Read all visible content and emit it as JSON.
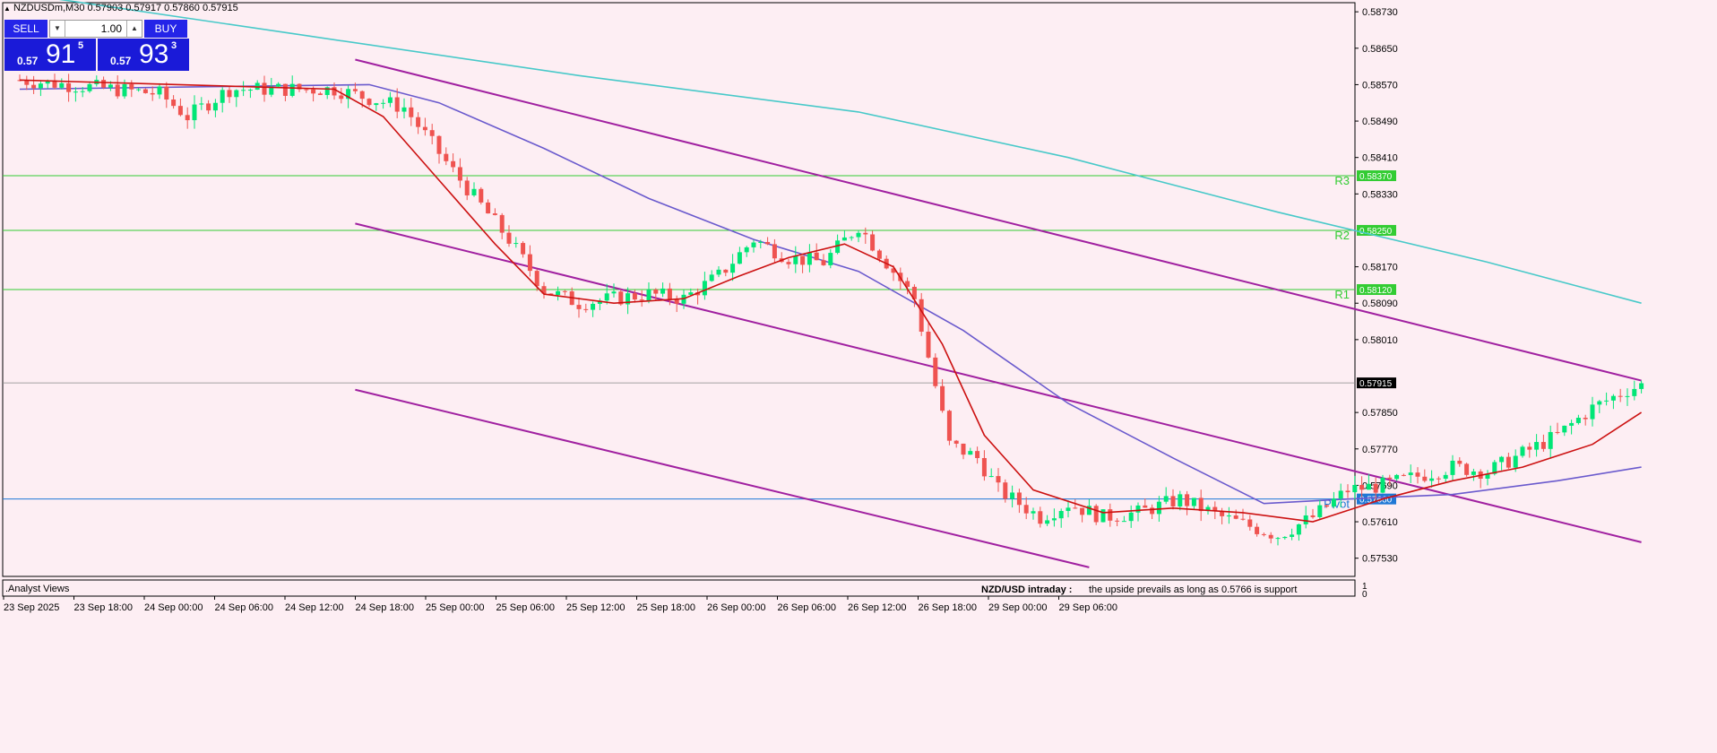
{
  "symbol_line": "NZDUSDm,M30  0.57903 0.57917 0.57860 0.57915",
  "trade_panel": {
    "sell_label": "SELL",
    "buy_label": "BUY",
    "lot": "1.00",
    "sell_prefix": "0.57",
    "sell_big": "91",
    "sell_sup": "5",
    "buy_prefix": "0.57",
    "buy_big": "93",
    "buy_sup": "3"
  },
  "subwindow_label": ".Analyst Views",
  "subwindow_scale": [
    "1",
    "0"
  ],
  "analyst_text": {
    "title": "NZD/USD intraday :",
    "body": "the upside prevails as long as 0.5766 is support"
  },
  "colors": {
    "background": "#fdeef3",
    "bull": "#00e676",
    "bear": "#ef5350",
    "sma_fast": "#cc1111",
    "sma_mid": "#6a5acd",
    "sma_slow": "#48c9c9",
    "channel": "#a020a0",
    "resistance": "#33cc33",
    "pivot": "#1f78d6",
    "price_line": "#888888"
  },
  "chart_data": {
    "type": "candlestick",
    "timeframe": "M30",
    "ylim": [
      0.5749,
      0.5875
    ],
    "y_ticks": [
      "0.58730",
      "0.58650",
      "0.58570",
      "0.58490",
      "0.58410",
      "0.58330",
      "0.58170",
      "0.58090",
      "0.58010",
      "0.57850",
      "0.57770",
      "0.57690",
      "0.57610",
      "0.57530"
    ],
    "x_ticks": [
      "23 Sep 2025",
      "23 Sep 18:00",
      "24 Sep 00:00",
      "24 Sep 06:00",
      "24 Sep 12:00",
      "24 Sep 18:00",
      "25 Sep 00:00",
      "25 Sep 06:00",
      "25 Sep 12:00",
      "25 Sep 18:00",
      "26 Sep 00:00",
      "26 Sep 06:00",
      "26 Sep 12:00",
      "26 Sep 18:00",
      "29 Sep 00:00",
      "29 Sep 06:00"
    ],
    "current_price": "0.57915",
    "levels": [
      {
        "name": "R3",
        "value": "0.58370",
        "color": "#33cc33"
      },
      {
        "name": "R2",
        "value": "0.58250",
        "color": "#33cc33"
      },
      {
        "name": "R1",
        "value": "0.58120",
        "color": "#33cc33"
      },
      {
        "name": "Pivot",
        "value": "0.57660",
        "color": "#1f78d6"
      }
    ],
    "candle_keypoints": [
      [
        0,
        0.5858
      ],
      [
        20,
        0.5855
      ],
      [
        24,
        0.585
      ],
      [
        30,
        0.5856
      ],
      [
        45,
        0.5856
      ],
      [
        55,
        0.5852
      ],
      [
        62,
        0.5838
      ],
      [
        70,
        0.5823
      ],
      [
        75,
        0.5812
      ],
      [
        80,
        0.5809
      ],
      [
        90,
        0.5811
      ],
      [
        95,
        0.581
      ],
      [
        100,
        0.5815
      ],
      [
        105,
        0.5823
      ],
      [
        110,
        0.5819
      ],
      [
        115,
        0.5818
      ],
      [
        120,
        0.5826
      ],
      [
        125,
        0.5816
      ],
      [
        128,
        0.581
      ],
      [
        133,
        0.5778
      ],
      [
        137,
        0.5775
      ],
      [
        140,
        0.5768
      ],
      [
        146,
        0.5762
      ],
      [
        150,
        0.5765
      ],
      [
        155,
        0.5762
      ],
      [
        160,
        0.5763
      ],
      [
        166,
        0.5766
      ],
      [
        172,
        0.5762
      ],
      [
        180,
        0.5758
      ],
      [
        185,
        0.5762
      ],
      [
        190,
        0.5768
      ],
      [
        195,
        0.5769
      ],
      [
        200,
        0.5771
      ],
      [
        205,
        0.5773
      ],
      [
        210,
        0.5772
      ],
      [
        215,
        0.5776
      ],
      [
        220,
        0.578
      ],
      [
        225,
        0.5786
      ],
      [
        230,
        0.579
      ],
      [
        232,
        0.5791
      ]
    ],
    "sma_fast_points": [
      [
        0,
        0.5858
      ],
      [
        45,
        0.5856
      ],
      [
        52,
        0.585
      ],
      [
        60,
        0.5836
      ],
      [
        68,
        0.5822
      ],
      [
        75,
        0.5811
      ],
      [
        85,
        0.5809
      ],
      [
        95,
        0.581
      ],
      [
        103,
        0.5815
      ],
      [
        110,
        0.5819
      ],
      [
        118,
        0.5822
      ],
      [
        125,
        0.5817
      ],
      [
        132,
        0.58
      ],
      [
        138,
        0.578
      ],
      [
        145,
        0.5768
      ],
      [
        155,
        0.5763
      ],
      [
        165,
        0.5764
      ],
      [
        175,
        0.5763
      ],
      [
        185,
        0.5761
      ],
      [
        195,
        0.5766
      ],
      [
        205,
        0.577
      ],
      [
        215,
        0.5773
      ],
      [
        225,
        0.5778
      ],
      [
        232,
        0.5785
      ]
    ],
    "sma_mid_points": [
      [
        0,
        0.5856
      ],
      [
        50,
        0.5857
      ],
      [
        60,
        0.5853
      ],
      [
        75,
        0.5843
      ],
      [
        90,
        0.5832
      ],
      [
        105,
        0.5823
      ],
      [
        120,
        0.5816
      ],
      [
        135,
        0.5803
      ],
      [
        150,
        0.5787
      ],
      [
        165,
        0.5775
      ],
      [
        178,
        0.5765
      ],
      [
        190,
        0.5766
      ],
      [
        205,
        0.5767
      ],
      [
        220,
        0.577
      ],
      [
        232,
        0.5773
      ]
    ],
    "sma_slow_points": [
      [
        0,
        0.5877
      ],
      [
        40,
        0.5868
      ],
      [
        80,
        0.5859
      ],
      [
        120,
        0.5851
      ],
      [
        150,
        0.5841
      ],
      [
        180,
        0.5829
      ],
      [
        210,
        0.5818
      ],
      [
        232,
        0.5809
      ]
    ],
    "channel_lines": [
      {
        "from": [
          48,
          0.58625
        ],
        "to": [
          232,
          0.5792
        ]
      },
      {
        "from": [
          48,
          0.58265
        ],
        "to": [
          232,
          0.57565
        ]
      },
      {
        "from": [
          48,
          0.579
        ],
        "to": [
          153,
          0.5751
        ]
      }
    ]
  }
}
